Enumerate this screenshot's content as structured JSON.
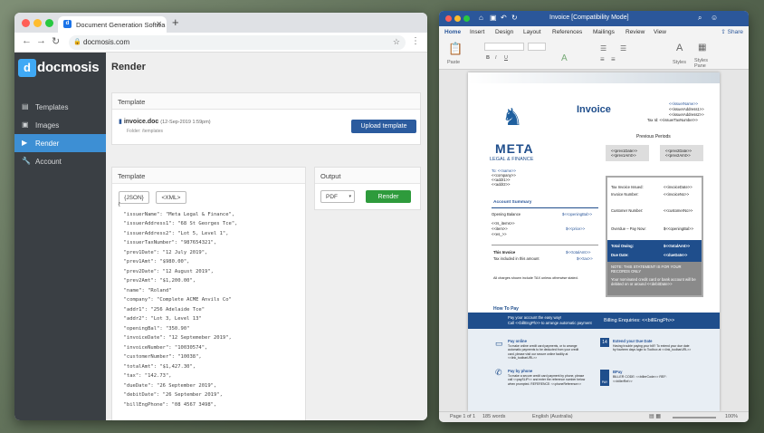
{
  "browser": {
    "tab_title": "Document Generation Softwa",
    "url": "docmosis.com",
    "logo": "docmosis",
    "logo_mark": "d",
    "sidebar": [
      {
        "label": "Templates",
        "icon": "layers-icon"
      },
      {
        "label": "Images",
        "icon": "image-icon"
      },
      {
        "label": "Render",
        "icon": "play-icon"
      },
      {
        "label": "Account",
        "icon": "wrench-icon"
      }
    ],
    "page_title": "Render",
    "template_card": {
      "title": "Template",
      "file_name": "invoice.doc",
      "file_date": "(12-Sep-2019 1:59pm)",
      "folder": "Folder: /templates",
      "upload_button": "Upload template"
    },
    "data_card": {
      "title": "Template",
      "json_button": "{JSON}",
      "xml_button": "<XML>",
      "json_lines": [
        "{",
        "  \"issuerName\": \"Meta Legal & Finance\",",
        "  \"issuerAddress1\": \"68 St Georges Tce\",",
        "  \"issuerAddress2\": \"Lot 5, Level 1\",",
        "  \"issuerTaxNumber\": \"987654321\",",
        "  \"prev1Date\": \"12 July 2019\",",
        "  \"prev1Amt\": \"$980.00\",",
        "  \"prev2Date\": \"12 August 2019\",",
        "  \"prev2Amt\": \"$1,200.00\",",
        "  \"name\": \"Roland\"",
        "  \"company\": \"Complete ACME Anvils Co\"",
        "  \"addr1\": \"256 Adelaide Tce\"",
        "  \"addr2\": \"Lot 3, Level 13\"",
        "  \"openingBal\": \"350.90\"",
        "  \"invoiceDate\": \"12 Septemeber 2019\",",
        "  \"invoiceNumber\": \"10030574\",",
        "  \"customerNumber\": \"10038\",",
        "  \"totalAmt\": \"$1,427.30\",",
        "  \"tax\": \"142.73\",",
        "  \"dueDate\": \"26 September 2019\",",
        "  \"debitDate\": \"26 September 2019\",",
        "  \"billEngPhone\": \"08 4567 3498\","
      ]
    },
    "output_card": {
      "title": "Output",
      "format": "PDF",
      "render_button": "Render"
    }
  },
  "word": {
    "title": "Invoice [Compatibility Mode]",
    "tabs": [
      "Home",
      "Insert",
      "Design",
      "Layout",
      "References",
      "Mailings",
      "Review",
      "View"
    ],
    "share": "Share",
    "ribbon": {
      "paste": "Paste",
      "styles": "Styles",
      "styles_pane": "Styles Pane"
    },
    "status": {
      "page": "Page 1 of 1",
      "words": "185 words",
      "language": "English (Australia)",
      "zoom": "100%"
    },
    "doc": {
      "heading": "Invoice",
      "issuer_fields": [
        "<<issuerName>>",
        "<<issuerAddress1>>",
        "<<issuerAddress2>>",
        "Tax Id: <<issuerTaxNumber>>"
      ],
      "brand": "META",
      "brand_sub": "LEGAL & FINANCE",
      "previous_periods": "Previous Periods",
      "prev1": [
        "<<prev1Date>>",
        "<<prev1Amt>>"
      ],
      "prev2": [
        "<<prev2Date>>",
        "<<prev2Amt>>"
      ],
      "to": [
        "To: <<name>>",
        "<<company>>",
        "<<addr1>>",
        "<<addr2>>"
      ],
      "invoice_issued": "Tax Invoice Issued:",
      "invoice_date": "<<invoiceDate>>",
      "invoice_number_label": "Invoice Number:",
      "invoice_number": "<<invoiceNo>>",
      "customer_number_label": "Customer Number:",
      "customer_number": "<<customerNo>>",
      "overdue_label": "Overdue – Pay Now:",
      "overdue": "$<<openingBal>>",
      "account_summary": "Account Summary",
      "opening_balance": "Opening Balance",
      "opening_balance_val": "$<<openingBal>>",
      "items": [
        "<<rs_items>>",
        "<<item>>",
        "<<es_>>"
      ],
      "item_price": "$<<price>>",
      "this_invoice": "This Invoice",
      "this_invoice_val": "$<<totalAmt>>",
      "tax_included": "Tax included in this amount",
      "tax_val": "$<<tax>>",
      "charges_note": "All charges shown include TAX unless otherwise stated.",
      "total_owing": "Total Owing:",
      "total_owing_val": "$<<totalAmt>>",
      "due_date": "Due Date:",
      "due_date_val": "<<dueDate>>",
      "note": "NOTE: THIS STATEMENT IS FOR YOUR RECORDS ONLY",
      "note2": "Your nominated credit card or bank account will be debited on or around <<debitDate>>",
      "how_to_pay": "How To Pay",
      "pay_easy": "Pay your account the easy way!",
      "pay_easy_sub": "Call <<billEngPh>> to arrange automatic payment",
      "billing": "Billing Enquiries: <<billEngPh>>",
      "pay_online": "Pay online",
      "pay_online_text": "To make online credit card payments, or to arrange automatic payments to be deducted from your credit card, please visit our secure online facility at <<link_toolbarURL>>",
      "extend": "Extend your Due Date",
      "extend_text": "Having trouble paying your bill? To extend your due date by fourteen days login to Toolbox at <<link_toolbarURL>>",
      "pay_phone": "Pay by phone",
      "pay_phone_text": "To make a secure credit card payment by phone, please call <<paySLIP>> and enter the reference number below when prompted. REFERENCE: <<phoneReference>>",
      "bpay": "BPay",
      "bpay_text": "BILLER CODE: <<billerCode>> REF: <<billerRef>>",
      "calendar_day": "14",
      "bpay_badge": "PAY"
    }
  },
  "colors": {
    "accent": "#3d8fd4",
    "word_blue": "#2b579a",
    "render_green": "#2e9b3c",
    "upload_blue": "#2b5b9e"
  }
}
